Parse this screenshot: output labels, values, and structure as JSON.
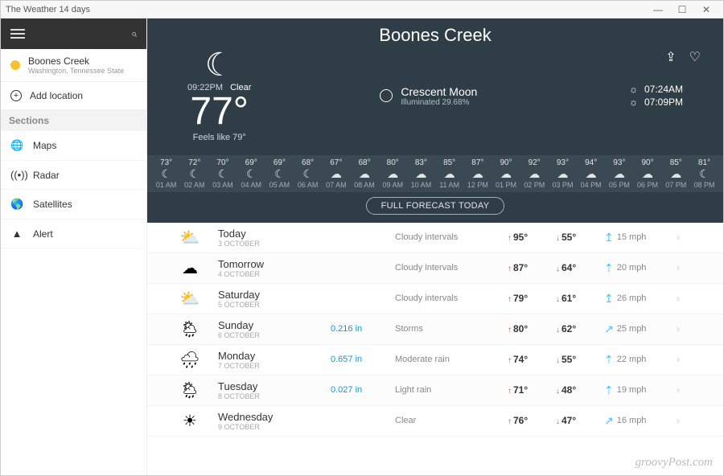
{
  "window": {
    "title": "The Weather 14 days",
    "minimize": "—",
    "maximize": "☐",
    "close": "✕"
  },
  "sidebar": {
    "location": {
      "name": "Boones Creek",
      "sub": "Washington, Tennessee State"
    },
    "add_label": "Add location",
    "sections_header": "Sections",
    "items": [
      {
        "icon": "globe-icon",
        "glyph": "🌐",
        "label": "Maps"
      },
      {
        "icon": "radar-icon",
        "glyph": "((•))",
        "label": "Radar"
      },
      {
        "icon": "earth-icon",
        "glyph": "🌎",
        "label": "Satellites"
      },
      {
        "icon": "alert-icon",
        "glyph": "▲",
        "label": "Alert"
      }
    ]
  },
  "hero": {
    "city": "Boones Creek",
    "time": "09:22PM",
    "condition": "Clear",
    "temp": "77°",
    "feels": "Feels like 79°",
    "moon": {
      "name": "Crescent Moon",
      "illum": "Illuminated 29.68%"
    },
    "sunrise": "07:24AM",
    "sunset": "07:09PM"
  },
  "hourly": [
    {
      "t": "73°",
      "ic": "☾",
      "lbl": "01 AM"
    },
    {
      "t": "72°",
      "ic": "☾",
      "lbl": "02 AM"
    },
    {
      "t": "70°",
      "ic": "☾",
      "lbl": "03 AM"
    },
    {
      "t": "69°",
      "ic": "☾",
      "lbl": "04 AM"
    },
    {
      "t": "69°",
      "ic": "☾",
      "lbl": "05 AM"
    },
    {
      "t": "68°",
      "ic": "☾",
      "lbl": "06 AM"
    },
    {
      "t": "67°",
      "ic": "☁",
      "lbl": "07 AM"
    },
    {
      "t": "68°",
      "ic": "☁",
      "lbl": "08 AM"
    },
    {
      "t": "80°",
      "ic": "☁",
      "lbl": "09 AM"
    },
    {
      "t": "83°",
      "ic": "☁",
      "lbl": "10 AM"
    },
    {
      "t": "85°",
      "ic": "☁",
      "lbl": "11 AM"
    },
    {
      "t": "87°",
      "ic": "☁",
      "lbl": "12 PM"
    },
    {
      "t": "90°",
      "ic": "☁",
      "lbl": "01 PM"
    },
    {
      "t": "92°",
      "ic": "☁",
      "lbl": "02 PM"
    },
    {
      "t": "93°",
      "ic": "☁",
      "lbl": "03 PM"
    },
    {
      "t": "94°",
      "ic": "☁",
      "lbl": "04 PM"
    },
    {
      "t": "93°",
      "ic": "☁",
      "lbl": "05 PM"
    },
    {
      "t": "90°",
      "ic": "☁",
      "lbl": "06 PM"
    },
    {
      "t": "85°",
      "ic": "☁",
      "lbl": "07 PM"
    },
    {
      "t": "81°",
      "ic": "☾",
      "lbl": "08 PM"
    }
  ],
  "full_forecast_label": "FULL FORECAST TODAY",
  "daily": [
    {
      "ic": "⛅",
      "name": "Today",
      "date": "3 OCTOBER",
      "precip": "",
      "cond": "Cloudy intervals",
      "hi": "95°",
      "lo": "55°",
      "wdir": "↥",
      "wind": "15 mph"
    },
    {
      "ic": "☁",
      "name": "Tomorrow",
      "date": "4 OCTOBER",
      "precip": "",
      "cond": "Cloudy intervals",
      "hi": "87°",
      "lo": "64°",
      "wdir": "⇡",
      "wind": "20 mph"
    },
    {
      "ic": "⛅",
      "name": "Saturday",
      "date": "5 OCTOBER",
      "precip": "",
      "cond": "Cloudy intervals",
      "hi": "79°",
      "lo": "61°",
      "wdir": "↥",
      "wind": "26 mph"
    },
    {
      "ic": "🌦",
      "name": "Sunday",
      "date": "6 OCTOBER",
      "precip": "0.216 in",
      "cond": "Storms",
      "hi": "80°",
      "lo": "62°",
      "wdir": "↗",
      "wind": "25 mph"
    },
    {
      "ic": "🌧",
      "name": "Monday",
      "date": "7 OCTOBER",
      "precip": "0.657 in",
      "cond": "Moderate rain",
      "hi": "74°",
      "lo": "55°",
      "wdir": "⇡",
      "wind": "22 mph"
    },
    {
      "ic": "🌦",
      "name": "Tuesday",
      "date": "8 OCTOBER",
      "precip": "0.027 in",
      "cond": "Light rain",
      "hi": "71°",
      "lo": "48°",
      "wdir": "⇡",
      "wind": "19 mph"
    },
    {
      "ic": "☀",
      "name": "Wednesday",
      "date": "9 OCTOBER",
      "precip": "",
      "cond": "Clear",
      "hi": "76°",
      "lo": "47°",
      "wdir": "↗",
      "wind": "16 mph"
    }
  ],
  "watermark": "groovyPost.com"
}
